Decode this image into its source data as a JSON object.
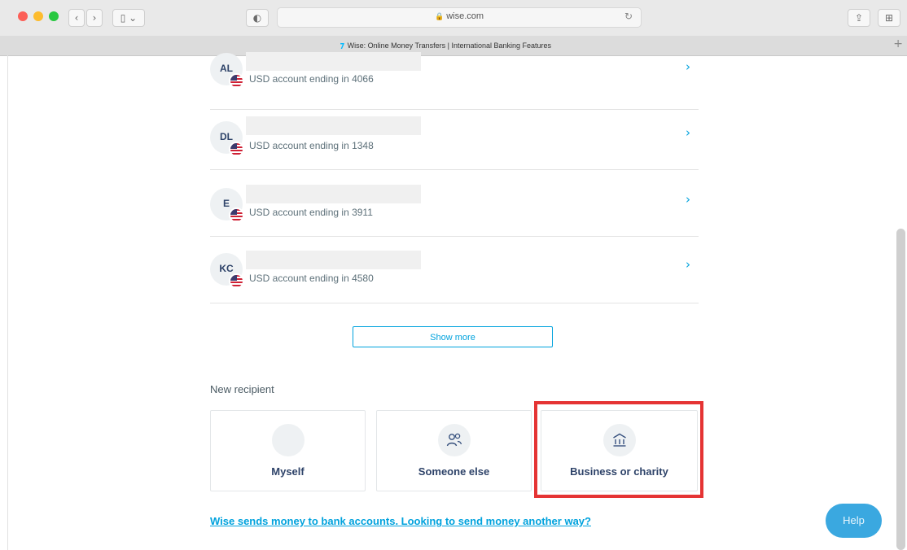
{
  "browser": {
    "url": "wise.com",
    "tab_title": "Wise: Online Money Transfers | International Banking Features",
    "back": "‹",
    "forward": "›",
    "sidebar_toggle": "▯ ⌄",
    "privacy_icon": "◐",
    "lock_icon": "🔒",
    "reload_icon": "↻",
    "share_icon": "⇪",
    "tabs_icon": "⊞",
    "new_tab_icon": "+"
  },
  "recipients": [
    {
      "initials": "AL",
      "account": "USD account ending in 4066",
      "flag": "us-flag-icon"
    },
    {
      "initials": "DL",
      "account": "USD account ending in 1348",
      "flag": "us-flag-icon"
    },
    {
      "initials": "E",
      "account": "USD account ending in 3911",
      "flag": "us-flag-icon"
    },
    {
      "initials": "KC",
      "account": "USD account ending in 4580",
      "flag": "us-flag-icon"
    }
  ],
  "chevron": "›",
  "show_more_label": "Show more",
  "new_recipient": {
    "title": "New recipient",
    "options": [
      {
        "label": "Myself",
        "icon": ""
      },
      {
        "label": "Someone else",
        "icon": "person-plus-icon"
      },
      {
        "label": "Business or charity",
        "icon": "bank-icon"
      }
    ]
  },
  "bottom_link": "Wise sends money to bank accounts. Looking to send money another way?",
  "help_label": "Help",
  "colors": {
    "accent": "#00a2dd",
    "navy": "#2e4369",
    "highlight": "#e53434",
    "help": "#3aa8e0"
  }
}
